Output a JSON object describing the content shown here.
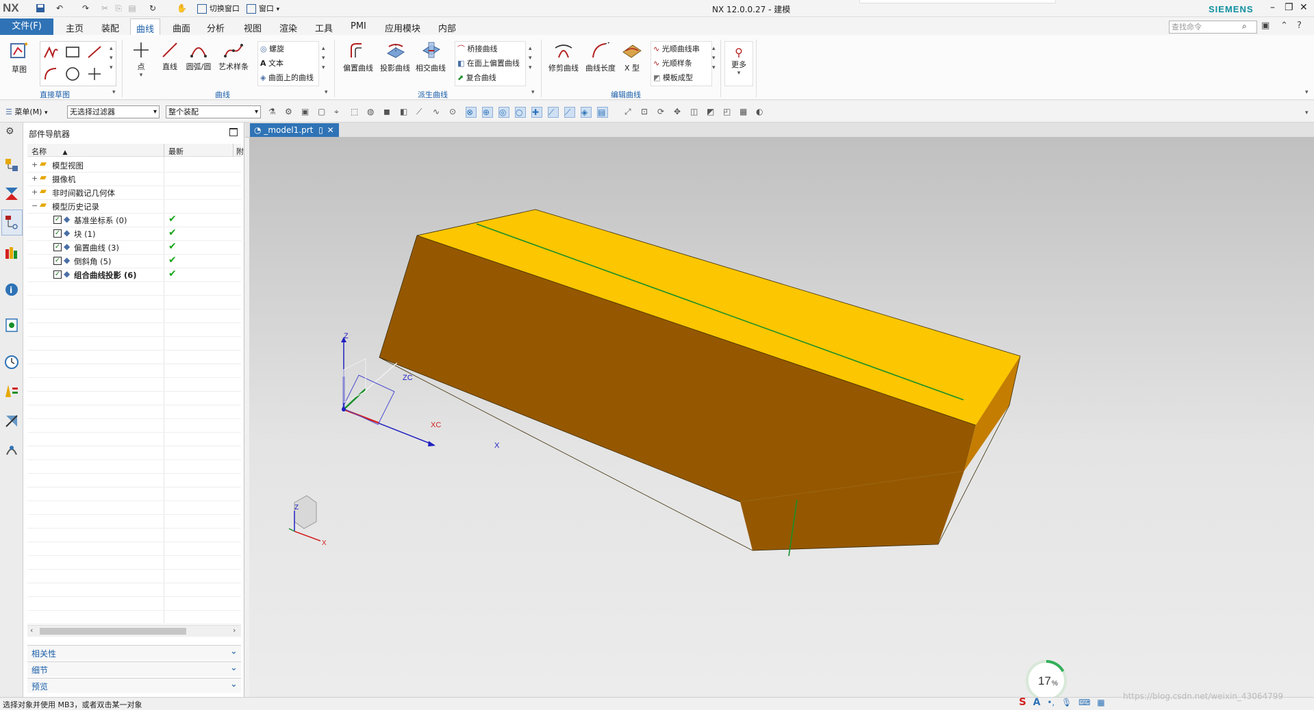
{
  "app": {
    "logo": "NX",
    "window_title": "NX 12.0.0.27 - 建模",
    "brand": "SIEMENS",
    "quick_access": {
      "switch_window": "切换窗口",
      "window": "窗口"
    }
  },
  "menu": {
    "file": "文件(F)",
    "tabs": [
      "主页",
      "装配",
      "曲线",
      "曲面",
      "分析",
      "视图",
      "渲染",
      "工具",
      "PMI",
      "应用模块",
      "内部"
    ],
    "active_tab": "曲线",
    "search_placeholder": "查找命令"
  },
  "ribbon": {
    "groups": {
      "direct_sketch": "直接草图",
      "curve": "曲线",
      "derived_curve": "派生曲线",
      "edit_curve": "编辑曲线"
    },
    "buttons": {
      "sketch": "草图",
      "point": "点",
      "line": "直线",
      "arc_circle": "圆弧/圆",
      "art_spline": "艺术样条",
      "helix": "螺旋",
      "text": "文本",
      "curve_on_surface": "曲面上的曲线",
      "offset_curve": "偏置曲线",
      "project_curve": "投影曲线",
      "intersect_curve": "相交曲线",
      "bridge_curve": "桥接曲线",
      "offset_on_face": "在面上偏置曲线",
      "composite_curve": "复合曲线",
      "trim_curve": "修剪曲线",
      "curve_length": "曲线长度",
      "x_form": "X 型",
      "smooth_curve_string": "光顺曲线串",
      "smooth_spline": "光顺样条",
      "template_shaping": "模板成型",
      "more": "更多"
    }
  },
  "toolbar2": {
    "menu": "菜单(M)",
    "filter": "无选择过滤器",
    "scope": "整个装配"
  },
  "navigator": {
    "title": "部件导航器",
    "columns": [
      "名称",
      "最新",
      "附"
    ],
    "items": [
      {
        "label": "模型视图",
        "level": 0,
        "check": false
      },
      {
        "label": "摄像机",
        "level": 0,
        "check": false
      },
      {
        "label": "非时间戳记几何体",
        "level": 0,
        "check": false
      },
      {
        "label": "模型历史记录",
        "level": 0,
        "check": false
      },
      {
        "label": "基准坐标系 (0)",
        "level": 1,
        "check": true
      },
      {
        "label": "块 (1)",
        "level": 1,
        "check": true
      },
      {
        "label": "偏置曲线 (3)",
        "level": 1,
        "check": true
      },
      {
        "label": "倒斜角 (5)",
        "level": 1,
        "check": true
      },
      {
        "label": "组合曲线投影 (6)",
        "level": 1,
        "check": true
      }
    ],
    "panels": [
      "相关性",
      "细节",
      "预览"
    ]
  },
  "graphics": {
    "tab_label": "_model1.prt",
    "axis_labels": {
      "z": "Z",
      "zc": "ZC",
      "xc": "XC",
      "x": "X"
    },
    "triad_labels": {
      "z": "Z",
      "x": "X"
    },
    "progress_percent": "17",
    "colors": {
      "top": "#fcc600",
      "front": "#955800",
      "side": "#c47d00",
      "edge_curve": "#1a8f2a"
    }
  },
  "status": {
    "prompt": "选择对象并使用 MB3，或者双击某一对象",
    "watermark": "https://blog.csdn.net/weixin_43064799"
  }
}
